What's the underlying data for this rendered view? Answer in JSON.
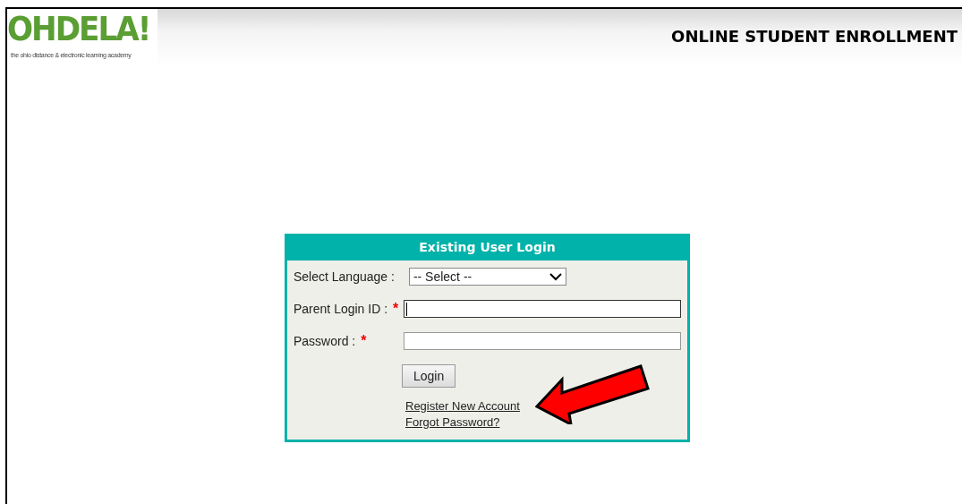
{
  "header": {
    "logo": "OHDELA!",
    "logo_tagline": "the ohio distance & electronic learning academy",
    "title": "ONLINE STUDENT ENROLLMENT"
  },
  "login": {
    "title": "Existing User Login",
    "fields": [
      {
        "kind": "select",
        "label": "Select Language :",
        "value": "-- Select --"
      },
      {
        "kind": "text",
        "label": "Parent Login ID :",
        "required_mark": "*",
        "focused": true
      },
      {
        "kind": "password",
        "label": "Password :",
        "required_mark": "*",
        "focused": false
      }
    ],
    "button": "Login",
    "links": [
      "Register New Account",
      "Forgot Password?"
    ]
  }
}
